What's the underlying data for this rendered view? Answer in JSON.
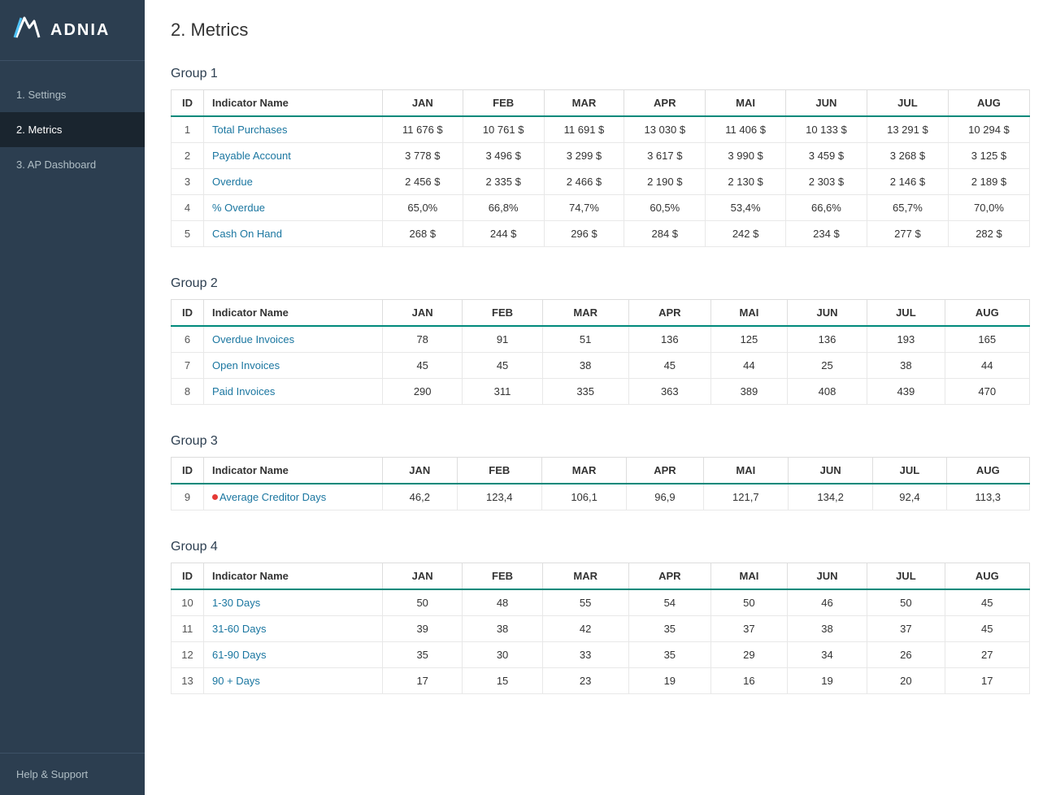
{
  "app": {
    "logo_icon": "//",
    "logo_text": "ADNIA"
  },
  "sidebar": {
    "nav_items": [
      {
        "id": "settings",
        "label": "1. Settings",
        "active": false
      },
      {
        "id": "metrics",
        "label": "2. Metrics",
        "active": true
      },
      {
        "id": "ap-dashboard",
        "label": "3. AP Dashboard",
        "active": false
      }
    ],
    "help_support_label": "Help & Support"
  },
  "page": {
    "title": "2. Metrics"
  },
  "groups": [
    {
      "id": "group1",
      "title": "Group 1",
      "columns": [
        "ID",
        "Indicator Name",
        "JAN",
        "FEB",
        "MAR",
        "APR",
        "MAI",
        "JUN",
        "JUL",
        "AUG"
      ],
      "rows": [
        {
          "id": 1,
          "name": "Total Purchases",
          "jan": "11 676 $",
          "feb": "10 761 $",
          "mar": "11 691 $",
          "apr": "13 030 $",
          "mai": "11 406 $",
          "jun": "10 133 $",
          "jul": "13 291 $",
          "aug": "10 294 $",
          "flag": false
        },
        {
          "id": 2,
          "name": "Payable Account",
          "jan": "3 778 $",
          "feb": "3 496 $",
          "mar": "3 299 $",
          "apr": "3 617 $",
          "mai": "3 990 $",
          "jun": "3 459 $",
          "jul": "3 268 $",
          "aug": "3 125 $",
          "flag": false
        },
        {
          "id": 3,
          "name": "Overdue",
          "jan": "2 456 $",
          "feb": "2 335 $",
          "mar": "2 466 $",
          "apr": "2 190 $",
          "mai": "2 130 $",
          "jun": "2 303 $",
          "jul": "2 146 $",
          "aug": "2 189 $",
          "flag": false
        },
        {
          "id": 4,
          "name": "% Overdue",
          "jan": "65,0%",
          "feb": "66,8%",
          "mar": "74,7%",
          "apr": "60,5%",
          "mai": "53,4%",
          "jun": "66,6%",
          "jul": "65,7%",
          "aug": "70,0%",
          "flag": false
        },
        {
          "id": 5,
          "name": "Cash On Hand",
          "jan": "268 $",
          "feb": "244 $",
          "mar": "296 $",
          "apr": "284 $",
          "mai": "242 $",
          "jun": "234 $",
          "jul": "277 $",
          "aug": "282 $",
          "flag": false
        }
      ]
    },
    {
      "id": "group2",
      "title": "Group 2",
      "columns": [
        "ID",
        "Indicator Name",
        "JAN",
        "FEB",
        "MAR",
        "APR",
        "MAI",
        "JUN",
        "JUL",
        "AUG"
      ],
      "rows": [
        {
          "id": 6,
          "name": "Overdue Invoices",
          "jan": "78",
          "feb": "91",
          "mar": "51",
          "apr": "136",
          "mai": "125",
          "jun": "136",
          "jul": "193",
          "aug": "165",
          "flag": false
        },
        {
          "id": 7,
          "name": "Open Invoices",
          "jan": "45",
          "feb": "45",
          "mar": "38",
          "apr": "45",
          "mai": "44",
          "jun": "25",
          "jul": "38",
          "aug": "44",
          "flag": false
        },
        {
          "id": 8,
          "name": "Paid Invoices",
          "jan": "290",
          "feb": "311",
          "mar": "335",
          "apr": "363",
          "mai": "389",
          "jun": "408",
          "jul": "439",
          "aug": "470",
          "flag": false
        }
      ]
    },
    {
      "id": "group3",
      "title": "Group 3",
      "columns": [
        "ID",
        "Indicator Name",
        "JAN",
        "FEB",
        "MAR",
        "APR",
        "MAI",
        "JUN",
        "JUL",
        "AUG"
      ],
      "rows": [
        {
          "id": 9,
          "name": "Average Creditor Days",
          "jan": "46,2",
          "feb": "123,4",
          "mar": "106,1",
          "apr": "96,9",
          "mai": "121,7",
          "jun": "134,2",
          "jul": "92,4",
          "aug": "113,3",
          "flag": true
        }
      ]
    },
    {
      "id": "group4",
      "title": "Group 4",
      "columns": [
        "ID",
        "Indicator Name",
        "JAN",
        "FEB",
        "MAR",
        "APR",
        "MAI",
        "JUN",
        "JUL",
        "AUG"
      ],
      "rows": [
        {
          "id": 10,
          "name": "1-30 Days",
          "jan": "50",
          "feb": "48",
          "mar": "55",
          "apr": "54",
          "mai": "50",
          "jun": "46",
          "jul": "50",
          "aug": "45",
          "flag": false
        },
        {
          "id": 11,
          "name": "31-60 Days",
          "jan": "39",
          "feb": "38",
          "mar": "42",
          "apr": "35",
          "mai": "37",
          "jun": "38",
          "jul": "37",
          "aug": "45",
          "flag": false
        },
        {
          "id": 12,
          "name": "61-90 Days",
          "jan": "35",
          "feb": "30",
          "mar": "33",
          "apr": "35",
          "mai": "29",
          "jun": "34",
          "jul": "26",
          "aug": "27",
          "flag": false
        },
        {
          "id": 13,
          "name": "90 + Days",
          "jan": "17",
          "feb": "15",
          "mar": "23",
          "apr": "19",
          "mai": "16",
          "jun": "19",
          "jul": "20",
          "aug": "17",
          "flag": false
        }
      ]
    }
  ]
}
